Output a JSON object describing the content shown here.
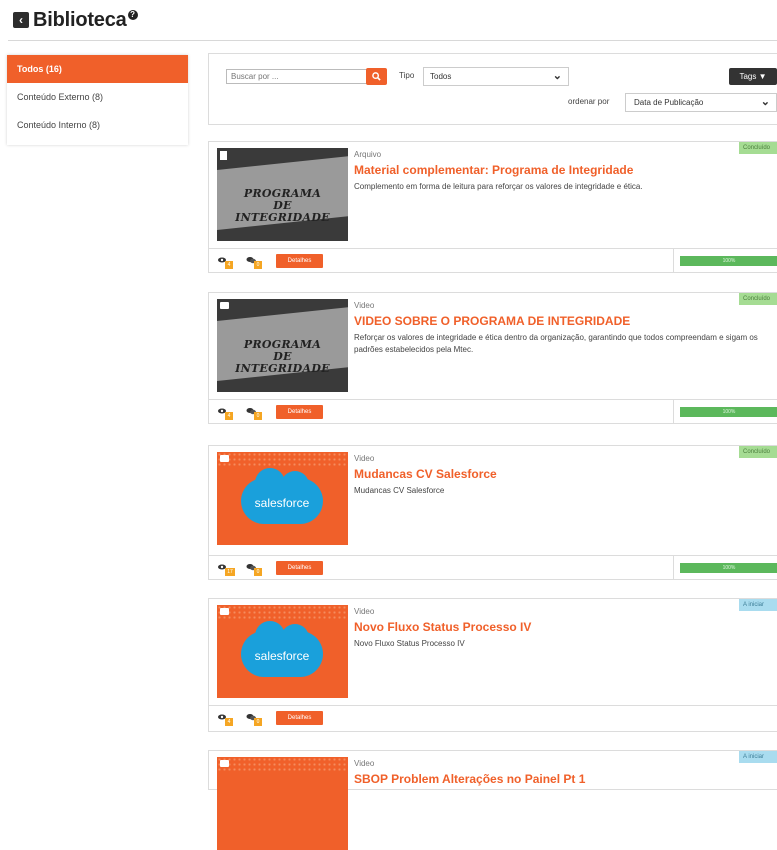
{
  "header": {
    "back_icon": "chevron-left-icon",
    "title": "Biblioteca",
    "help_icon": "question-circle-icon"
  },
  "sidebar": {
    "items": [
      {
        "label": "Todos (16)",
        "active": true
      },
      {
        "label": "Conteúdo Externo (8)",
        "active": false
      },
      {
        "label": "Conteúdo Interno (8)",
        "active": false
      }
    ]
  },
  "filter": {
    "search_placeholder": "Buscar por ...",
    "search_icon": "search-icon",
    "tipo_label": "Tipo",
    "tipo_value": "Todos",
    "tags_label": "Tags",
    "ordenar_label": "ordenar por",
    "ordenar_value": "Data de Publicação"
  },
  "colors": {
    "accent": "#f0602a",
    "progress": "#5cb85c",
    "done": "#a5dc93",
    "start": "#a9dcef"
  },
  "cards": [
    {
      "type": "Arquivo",
      "title": "Material complementar: Programa de Integridade",
      "description": "Complemento em forma de leitura para reforçar os valores de integridade e ética.",
      "status": "Concluído",
      "thumb_text": [
        "PROGRAMA",
        "DE",
        "INTEGRIDADE"
      ],
      "views": "4",
      "comments": "0",
      "details_label": "Detalhes",
      "progress": "100%"
    },
    {
      "type": "Video",
      "title": "VIDEO SOBRE O PROGRAMA DE INTEGRIDADE",
      "description": "Reforçar os valores de integridade e ética dentro da organização, garantindo que todos compreendam e sigam os padrões estabelecidos pela Mtec.",
      "status": "Concluído",
      "thumb_text": [
        "PROGRAMA",
        "DE",
        "INTEGRIDADE"
      ],
      "views": "4",
      "comments": "0",
      "details_label": "Detalhes",
      "progress": "100%"
    },
    {
      "type": "Video",
      "title": "Mudancas CV Salesforce",
      "description": "Mudancas CV Salesforce",
      "status": "Concluído",
      "thumb_text": "salesforce",
      "views": "17",
      "comments": "0",
      "details_label": "Detalhes",
      "progress": "100%"
    },
    {
      "type": "Video",
      "title": "Novo Fluxo Status Processo IV",
      "description": "Novo Fluxo Status Processo IV",
      "status": "A iniciar",
      "thumb_text": "salesforce",
      "views": "4",
      "comments": "0",
      "details_label": "Detalhes"
    },
    {
      "type": "Video",
      "title": "SBOP Problem Alterações no Painel Pt 1",
      "status": "A iniciar"
    }
  ]
}
